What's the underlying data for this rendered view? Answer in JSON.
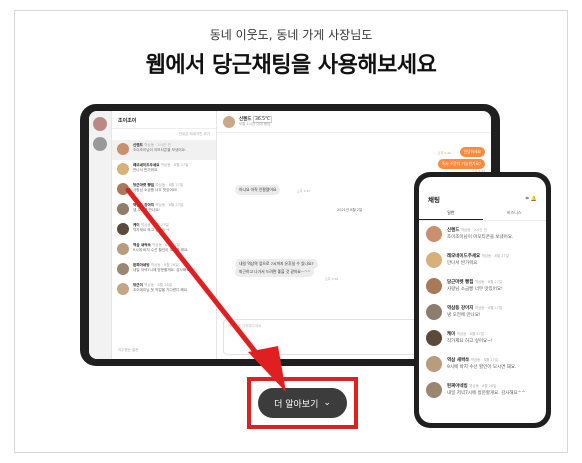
{
  "hero": {
    "subtitle": "동네 이웃도, 동네 가게 사장님도",
    "headline": "웹에서 당근채팅을 사용해보세요"
  },
  "tablet": {
    "list_title": "조이조이",
    "filter_text": "안읽은 메세지만 보기",
    "footer": "자주묻는 질문",
    "chats": [
      {
        "name": "신렌드",
        "meta": "역삼동 · 2시간 전",
        "msg": "조이조이님이 아모티콘을 보냈어요."
      },
      {
        "name": "레모네이드주세요",
        "meta": "역삼동 · 8월 27일",
        "msg": "만나서 반가워요"
      },
      {
        "name": "당근마켓 빵집",
        "meta": "역삼동 · 8월 27일",
        "msg": "사랑님 소금빵 너무 맛있어요!"
      },
      {
        "name": "역삼동 강아지",
        "meta": "역삼동 · 8월 27일",
        "msg": "넹 오전에 만나요!"
      },
      {
        "name": "케이",
        "meta": "역삼동 · 8월 27일",
        "msg": "작가제요 하고 싶어요~!"
      },
      {
        "name": "역삼 새싹쏘",
        "meta": "역삼동 · 8월 27일",
        "msg": "9시에 바지 수선 할인이 모시면 돼요."
      },
      {
        "name": "된찌아네빙",
        "meta": "역삼동 · 8월 26일",
        "msg": "내일 저녁7시에 방문할게요. 감사해요^^"
      },
      {
        "name": "당근이",
        "meta": "역삼동 · 8월 26일",
        "msg": "조이데이님 첫 약걸을 기다렸다 해요"
      }
    ],
    "conv_name": "신렌드",
    "conv_badge": "36.5℃",
    "conv_status": "보통 1시간 이내 응답",
    "messages": {
      "m1": "안녕하세요",
      "m2": "혹시 주문이 가능한가요?",
      "y1": "아니요 아직 안팔렸어요",
      "date": "2021년 8월 2일",
      "y2a": "내일 역삼역 앞으로 7시까지 유후실 수 있나요?",
      "y2b": "퇴근하고 나가서 드려면 좋을 것 같아요~^^",
      "t1": "오후 3:40",
      "t2": "오후 3:44",
      "t3": "오후 3:45",
      "t4": "오후 3:46",
      "t5": "오후 3:48"
    },
    "compose_placeholder": "메시지를 입력해주세요",
    "send_label": "전송"
  },
  "phone": {
    "title": "채팅",
    "icon_left": "⌗",
    "icon_right": "🔔",
    "tabs": [
      "일반",
      "비즈니스"
    ],
    "chats": [
      {
        "name": "신렌드",
        "meta": "역삼동 · 2시간 전",
        "msg": "조이조이님이 아모티콘을 보냈어요."
      },
      {
        "name": "레모네이드주세요",
        "meta": "역삼동 · 8월 27일",
        "msg": "만나서 반가워요"
      },
      {
        "name": "당근마켓 빵집",
        "meta": "역삼동 · 8월 27일",
        "msg": "사랑님 소금빵 너무 맛있어요!"
      },
      {
        "name": "역삼동 강아지",
        "meta": "역삼동 · 8월 27일",
        "msg": "넹 오전에 만나요!"
      },
      {
        "name": "케이",
        "meta": "역삼동 · 8월 27일",
        "msg": "작가제요 하고 싶어요~!"
      },
      {
        "name": "역삼 새싹쏘",
        "meta": "역삼동 · 8월 27일",
        "msg": "9시에 바지 수선 할인이 모시면 돼요."
      },
      {
        "name": "된찌아네빙",
        "meta": "역삼동 · 8월 26일",
        "msg": "내일 저녁7시에 방문할게요. 감사해요^^"
      }
    ]
  },
  "cta": {
    "label": "더 알아보기",
    "chevron": "⌄"
  },
  "colors": {
    "accent": "#ff8a3d",
    "highlight": "#e02020"
  }
}
